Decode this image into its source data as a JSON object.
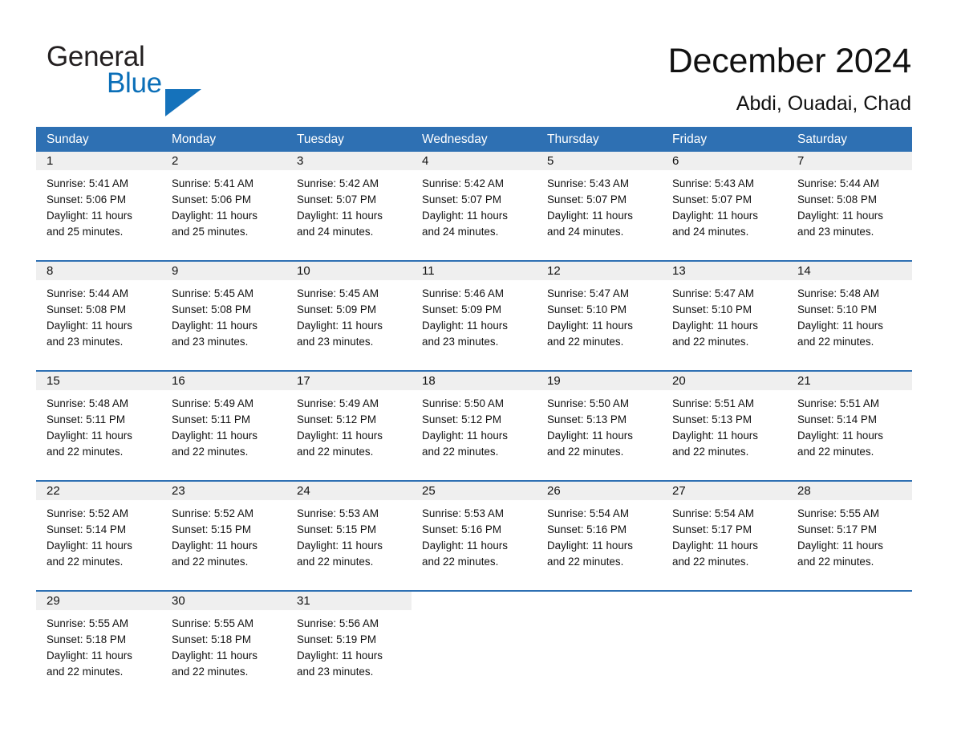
{
  "brand": {
    "word_one": "General",
    "word_two": "Blue",
    "triangle_icon": "triangle-icon",
    "accent_color": "#0b6fb8"
  },
  "header": {
    "title": "December 2024",
    "subtitle": "Abdi, Ouadai, Chad"
  },
  "theme": {
    "header_blue": "#2e70b3",
    "daynum_gray": "#efefef",
    "text": "#111111"
  },
  "calendar": {
    "weekday_headers": [
      "Sunday",
      "Monday",
      "Tuesday",
      "Wednesday",
      "Thursday",
      "Friday",
      "Saturday"
    ],
    "weeks": [
      {
        "days": [
          {
            "date": "1",
            "sunrise": "Sunrise: 5:41 AM",
            "sunset": "Sunset: 5:06 PM",
            "daylight_line1": "Daylight: 11 hours",
            "daylight_line2": "and 25 minutes."
          },
          {
            "date": "2",
            "sunrise": "Sunrise: 5:41 AM",
            "sunset": "Sunset: 5:06 PM",
            "daylight_line1": "Daylight: 11 hours",
            "daylight_line2": "and 25 minutes."
          },
          {
            "date": "3",
            "sunrise": "Sunrise: 5:42 AM",
            "sunset": "Sunset: 5:07 PM",
            "daylight_line1": "Daylight: 11 hours",
            "daylight_line2": "and 24 minutes."
          },
          {
            "date": "4",
            "sunrise": "Sunrise: 5:42 AM",
            "sunset": "Sunset: 5:07 PM",
            "daylight_line1": "Daylight: 11 hours",
            "daylight_line2": "and 24 minutes."
          },
          {
            "date": "5",
            "sunrise": "Sunrise: 5:43 AM",
            "sunset": "Sunset: 5:07 PM",
            "daylight_line1": "Daylight: 11 hours",
            "daylight_line2": "and 24 minutes."
          },
          {
            "date": "6",
            "sunrise": "Sunrise: 5:43 AM",
            "sunset": "Sunset: 5:07 PM",
            "daylight_line1": "Daylight: 11 hours",
            "daylight_line2": "and 24 minutes."
          },
          {
            "date": "7",
            "sunrise": "Sunrise: 5:44 AM",
            "sunset": "Sunset: 5:08 PM",
            "daylight_line1": "Daylight: 11 hours",
            "daylight_line2": "and 23 minutes."
          }
        ]
      },
      {
        "days": [
          {
            "date": "8",
            "sunrise": "Sunrise: 5:44 AM",
            "sunset": "Sunset: 5:08 PM",
            "daylight_line1": "Daylight: 11 hours",
            "daylight_line2": "and 23 minutes."
          },
          {
            "date": "9",
            "sunrise": "Sunrise: 5:45 AM",
            "sunset": "Sunset: 5:08 PM",
            "daylight_line1": "Daylight: 11 hours",
            "daylight_line2": "and 23 minutes."
          },
          {
            "date": "10",
            "sunrise": "Sunrise: 5:45 AM",
            "sunset": "Sunset: 5:09 PM",
            "daylight_line1": "Daylight: 11 hours",
            "daylight_line2": "and 23 minutes."
          },
          {
            "date": "11",
            "sunrise": "Sunrise: 5:46 AM",
            "sunset": "Sunset: 5:09 PM",
            "daylight_line1": "Daylight: 11 hours",
            "daylight_line2": "and 23 minutes."
          },
          {
            "date": "12",
            "sunrise": "Sunrise: 5:47 AM",
            "sunset": "Sunset: 5:10 PM",
            "daylight_line1": "Daylight: 11 hours",
            "daylight_line2": "and 22 minutes."
          },
          {
            "date": "13",
            "sunrise": "Sunrise: 5:47 AM",
            "sunset": "Sunset: 5:10 PM",
            "daylight_line1": "Daylight: 11 hours",
            "daylight_line2": "and 22 minutes."
          },
          {
            "date": "14",
            "sunrise": "Sunrise: 5:48 AM",
            "sunset": "Sunset: 5:10 PM",
            "daylight_line1": "Daylight: 11 hours",
            "daylight_line2": "and 22 minutes."
          }
        ]
      },
      {
        "days": [
          {
            "date": "15",
            "sunrise": "Sunrise: 5:48 AM",
            "sunset": "Sunset: 5:11 PM",
            "daylight_line1": "Daylight: 11 hours",
            "daylight_line2": "and 22 minutes."
          },
          {
            "date": "16",
            "sunrise": "Sunrise: 5:49 AM",
            "sunset": "Sunset: 5:11 PM",
            "daylight_line1": "Daylight: 11 hours",
            "daylight_line2": "and 22 minutes."
          },
          {
            "date": "17",
            "sunrise": "Sunrise: 5:49 AM",
            "sunset": "Sunset: 5:12 PM",
            "daylight_line1": "Daylight: 11 hours",
            "daylight_line2": "and 22 minutes."
          },
          {
            "date": "18",
            "sunrise": "Sunrise: 5:50 AM",
            "sunset": "Sunset: 5:12 PM",
            "daylight_line1": "Daylight: 11 hours",
            "daylight_line2": "and 22 minutes."
          },
          {
            "date": "19",
            "sunrise": "Sunrise: 5:50 AM",
            "sunset": "Sunset: 5:13 PM",
            "daylight_line1": "Daylight: 11 hours",
            "daylight_line2": "and 22 minutes."
          },
          {
            "date": "20",
            "sunrise": "Sunrise: 5:51 AM",
            "sunset": "Sunset: 5:13 PM",
            "daylight_line1": "Daylight: 11 hours",
            "daylight_line2": "and 22 minutes."
          },
          {
            "date": "21",
            "sunrise": "Sunrise: 5:51 AM",
            "sunset": "Sunset: 5:14 PM",
            "daylight_line1": "Daylight: 11 hours",
            "daylight_line2": "and 22 minutes."
          }
        ]
      },
      {
        "days": [
          {
            "date": "22",
            "sunrise": "Sunrise: 5:52 AM",
            "sunset": "Sunset: 5:14 PM",
            "daylight_line1": "Daylight: 11 hours",
            "daylight_line2": "and 22 minutes."
          },
          {
            "date": "23",
            "sunrise": "Sunrise: 5:52 AM",
            "sunset": "Sunset: 5:15 PM",
            "daylight_line1": "Daylight: 11 hours",
            "daylight_line2": "and 22 minutes."
          },
          {
            "date": "24",
            "sunrise": "Sunrise: 5:53 AM",
            "sunset": "Sunset: 5:15 PM",
            "daylight_line1": "Daylight: 11 hours",
            "daylight_line2": "and 22 minutes."
          },
          {
            "date": "25",
            "sunrise": "Sunrise: 5:53 AM",
            "sunset": "Sunset: 5:16 PM",
            "daylight_line1": "Daylight: 11 hours",
            "daylight_line2": "and 22 minutes."
          },
          {
            "date": "26",
            "sunrise": "Sunrise: 5:54 AM",
            "sunset": "Sunset: 5:16 PM",
            "daylight_line1": "Daylight: 11 hours",
            "daylight_line2": "and 22 minutes."
          },
          {
            "date": "27",
            "sunrise": "Sunrise: 5:54 AM",
            "sunset": "Sunset: 5:17 PM",
            "daylight_line1": "Daylight: 11 hours",
            "daylight_line2": "and 22 minutes."
          },
          {
            "date": "28",
            "sunrise": "Sunrise: 5:55 AM",
            "sunset": "Sunset: 5:17 PM",
            "daylight_line1": "Daylight: 11 hours",
            "daylight_line2": "and 22 minutes."
          }
        ]
      },
      {
        "days": [
          {
            "date": "29",
            "sunrise": "Sunrise: 5:55 AM",
            "sunset": "Sunset: 5:18 PM",
            "daylight_line1": "Daylight: 11 hours",
            "daylight_line2": "and 22 minutes."
          },
          {
            "date": "30",
            "sunrise": "Sunrise: 5:55 AM",
            "sunset": "Sunset: 5:18 PM",
            "daylight_line1": "Daylight: 11 hours",
            "daylight_line2": "and 22 minutes."
          },
          {
            "date": "31",
            "sunrise": "Sunrise: 5:56 AM",
            "sunset": "Sunset: 5:19 PM",
            "daylight_line1": "Daylight: 11 hours",
            "daylight_line2": "and 23 minutes."
          },
          {
            "date": "",
            "sunrise": "",
            "sunset": "",
            "daylight_line1": "",
            "daylight_line2": ""
          },
          {
            "date": "",
            "sunrise": "",
            "sunset": "",
            "daylight_line1": "",
            "daylight_line2": ""
          },
          {
            "date": "",
            "sunrise": "",
            "sunset": "",
            "daylight_line1": "",
            "daylight_line2": ""
          },
          {
            "date": "",
            "sunrise": "",
            "sunset": "",
            "daylight_line1": "",
            "daylight_line2": ""
          }
        ]
      }
    ]
  }
}
